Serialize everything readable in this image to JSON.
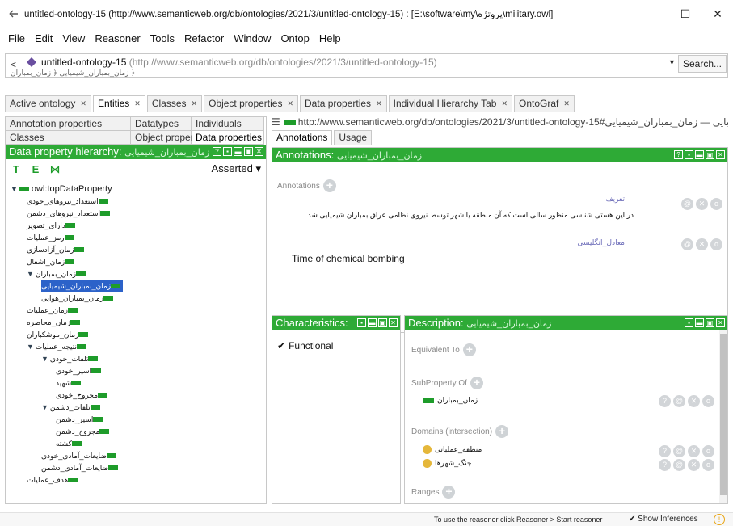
{
  "window": {
    "title": "untitled-ontology-15 (http://www.semanticweb.org/db/ontologies/2021/3/untitled-ontology-15) : [E:\\software\\my\\پروتژه\\military.owl]",
    "minimize": "—",
    "maximize": "☐",
    "close": "✕"
  },
  "menu": [
    "File",
    "Edit",
    "View",
    "Reasoner",
    "Tools",
    "Refactor",
    "Window",
    "Ontop",
    "Help"
  ],
  "address": {
    "back": "<",
    "ontology_name": "untitled-ontology-15",
    "ontology_iri": "(http://www.semanticweb.org/db/ontologies/2021/3/untitled-ontology-15)",
    "breadcrumb": "زمان_بمباران_شیمیایی ﴿ زمان_بمباران ﴿",
    "search_label": "Search..."
  },
  "main_tabs": [
    {
      "label": "Active ontology",
      "active": false
    },
    {
      "label": "Entities",
      "active": true
    },
    {
      "label": "Classes",
      "active": false
    },
    {
      "label": "Object properties",
      "active": false
    },
    {
      "label": "Data properties",
      "active": false
    },
    {
      "label": "Individual Hierarchy Tab",
      "active": false
    },
    {
      "label": "OntoGraf",
      "active": false
    }
  ],
  "left": {
    "subtabs_row1": [
      "Annotation properties",
      "Datatypes",
      "Individuals"
    ],
    "subtabs_row2": [
      "Classes",
      "Object properties",
      "Data properties"
    ],
    "header_prefix": "Data property hierarchy:",
    "header_entity": "زمان_بمباران_شیمیایی",
    "asserted_label": "Asserted ▾",
    "tree": [
      {
        "label": "owl:topDataProperty",
        "level": 0,
        "toggle": "▼",
        "root": true
      },
      {
        "label": "استعداد_نیروهای_خودی",
        "level": 1
      },
      {
        "label": "استعداد_نیروهای_دشمن",
        "level": 1
      },
      {
        "label": "دارای_تصویر",
        "level": 1
      },
      {
        "label": "رمز_عملیات",
        "level": 1
      },
      {
        "label": "زمان_آزادسازی",
        "level": 1
      },
      {
        "label": "زمان_اشغال",
        "level": 1
      },
      {
        "label": "زمان_بمباران",
        "level": 1,
        "toggle": "▼"
      },
      {
        "label": "زمان_بمباران_شیمیایی",
        "level": 2,
        "selected": true
      },
      {
        "label": "زمان_بمباران_هوایی",
        "level": 2
      },
      {
        "label": "زمان_عملیات",
        "level": 1
      },
      {
        "label": "زمان_محاصره",
        "level": 1
      },
      {
        "label": "زمان_موشکباران",
        "level": 1
      },
      {
        "label": "نتیجه_عملیات",
        "level": 1,
        "toggle": "▼"
      },
      {
        "label": "تلفات_خودی",
        "level": 2,
        "toggle": "▼"
      },
      {
        "label": "اسیر_خودی",
        "level": 3
      },
      {
        "label": "شهید",
        "level": 3
      },
      {
        "label": "مجروح_خودی",
        "level": 3
      },
      {
        "label": "تلفات_دشمن",
        "level": 2,
        "toggle": "▼"
      },
      {
        "label": "اسیر_دشمن",
        "level": 3
      },
      {
        "label": "مجروح_دشمن",
        "level": 3
      },
      {
        "label": "کشته",
        "level": 3
      },
      {
        "label": "ضایعات_آمادی_خودی",
        "level": 2
      },
      {
        "label": "ضایعات_آمادی_دشمن",
        "level": 2
      },
      {
        "label": "هدف_عملیات",
        "level": 1
      }
    ]
  },
  "right": {
    "iri_line": "http://www.semanticweb.org/db/ontologies/2021/3/untitled-ontology-15#زمان_بمباران_شیمیایی — زمان_بمباران_شیمیایی",
    "tabs": [
      {
        "label": "Annotations",
        "active": true
      },
      {
        "label": "Usage",
        "active": false
      }
    ],
    "annotations_header": "Annotations:",
    "annotations_entity": "زمان_بمباران_شیمیایی",
    "annotations_label": "Annotations",
    "annotations": [
      {
        "property": "تعریف",
        "value": "در این هستی شناسی منظور سالی است که آن منطقه یا شهر توسط نیروی نظامی عراق بمباران شیمیایی شد",
        "english": false
      },
      {
        "property": "معادل_انگلیسی",
        "value": "Time of chemical bombing",
        "english": true
      }
    ],
    "characteristics_header": "Characteristics:",
    "functional_label": "Functional",
    "description_header": "Description:",
    "description_entity": "زمان_بمباران_شیمیایی",
    "equivalent_to": "Equivalent To",
    "subproperty_of": "SubProperty Of",
    "subproperty_value": "زمان_بمباران",
    "domains": "Domains (intersection)",
    "domain_values": [
      "منطقه_عملیاتی",
      "جنگ_شهرها"
    ],
    "ranges": "Ranges"
  },
  "status": {
    "message": "To use the reasoner click Reasoner > Start reasoner",
    "show_inferences": "Show Inferences",
    "warn": "!"
  }
}
